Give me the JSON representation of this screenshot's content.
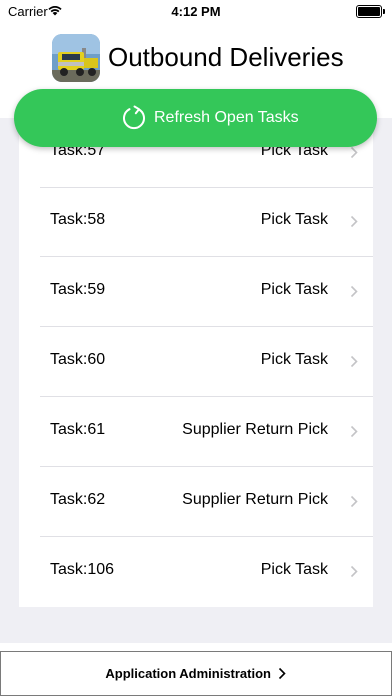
{
  "status_bar": {
    "carrier": "Carrier",
    "time": "4:12 PM"
  },
  "header": {
    "title": "Outbound Deliveries",
    "logo": "truck-logo"
  },
  "refresh_button": {
    "label": "Refresh Open Tasks",
    "icon": "refresh-icon"
  },
  "tasks": [
    {
      "name": "Task:57",
      "type": "Pick Task"
    },
    {
      "name": "Task:58",
      "type": "Pick Task"
    },
    {
      "name": "Task:59",
      "type": "Pick Task"
    },
    {
      "name": "Task:60",
      "type": "Pick Task"
    },
    {
      "name": "Task:61",
      "type": "Supplier Return Pick"
    },
    {
      "name": "Task:62",
      "type": "Supplier Return Pick"
    },
    {
      "name": "Task:106",
      "type": "Pick Task"
    }
  ],
  "footer": {
    "admin_label": "Application Administration"
  },
  "colors": {
    "accent": "#34c759",
    "list_background": "#efeff4"
  }
}
